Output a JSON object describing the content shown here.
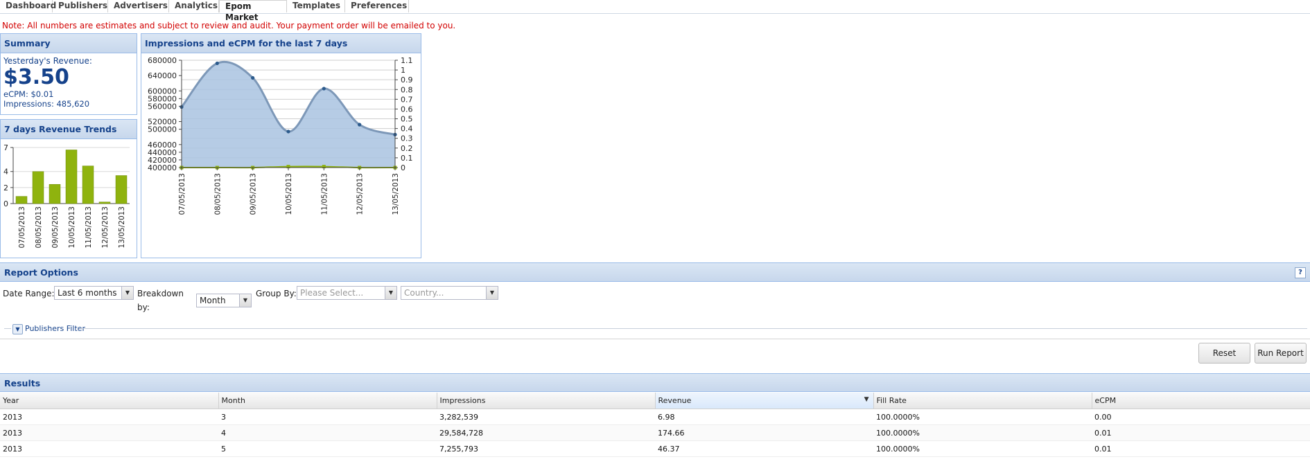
{
  "tabs": [
    "Dashboard",
    "Publishers",
    "Advertisers",
    "Analytics",
    "Epom Market",
    "Templates",
    "Preferences"
  ],
  "active_tab": "Epom Market",
  "note": "Note: All numbers are estimates and subject to review and audit. Your payment order will be emailed to you.",
  "summary": {
    "title": "Summary",
    "revenue_label": "Yesterday's Revenue:",
    "revenue": "$3.50",
    "ecpm": "eCPM: $0.01",
    "impressions": "Impressions: 485,620"
  },
  "trends": {
    "title": "7 days Revenue Trends"
  },
  "impressions_chart": {
    "title": "Impressions and eCPM for the last 7 days"
  },
  "chart_data": [
    {
      "type": "bar",
      "title": "7 days Revenue Trends",
      "categories": [
        "07/05/2013",
        "08/05/2013",
        "09/05/2013",
        "10/05/2013",
        "11/05/2013",
        "12/05/2013",
        "13/05/2013"
      ],
      "values": [
        0.9,
        4.0,
        2.4,
        6.7,
        4.7,
        0.2,
        3.5
      ],
      "ylim": [
        0,
        7
      ],
      "yticks": [
        0,
        2,
        4,
        7
      ],
      "color": "#8fb30e"
    },
    {
      "type": "area",
      "title": "Impressions and eCPM for the last 7 days",
      "categories": [
        "07/05/2013",
        "08/05/2013",
        "09/05/2013",
        "10/05/2013",
        "11/05/2013",
        "12/05/2013",
        "13/05/2013"
      ],
      "series": [
        {
          "axis": "left",
          "values": [
            558000,
            672000,
            634000,
            494000,
            606000,
            512000,
            486000
          ],
          "color": "#336699"
        },
        {
          "axis": "right",
          "values": [
            0.0,
            0.0,
            0.0,
            0.01,
            0.01,
            0.0,
            0.0
          ],
          "color": "#8fb30e"
        }
      ],
      "left_ylim": [
        400000,
        680000
      ],
      "left_yticks": [
        400000,
        420000,
        440000,
        460000,
        500000,
        520000,
        560000,
        580000,
        600000,
        640000,
        680000
      ],
      "right_ylim": [
        0,
        1.1
      ],
      "right_yticks": [
        0,
        0.1,
        0.2,
        0.3,
        0.4,
        0.5,
        0.6,
        0.7,
        0.8,
        0.9,
        1,
        1.1
      ]
    }
  ],
  "report_options": {
    "title": "Report Options",
    "help": "?",
    "date_range_label": "Date Range:",
    "date_range_value": "Last 6 months",
    "breakdown_label_1": "Breakdown",
    "breakdown_label_2": "by:",
    "breakdown_value": "Month",
    "group_by_label": "Group By:",
    "group_by_placeholder": "Please Select...",
    "country_placeholder": "Country...",
    "publishers_filter": "Publishers Filter",
    "reset": "Reset",
    "run_report": "Run Report"
  },
  "results": {
    "title": "Results",
    "columns": [
      "Year",
      "Month",
      "Impressions",
      "Revenue",
      "Fill Rate",
      "eCPM"
    ],
    "rows": [
      [
        "2013",
        "3",
        "3,282,539",
        "6.98",
        "100.0000%",
        "0.00"
      ],
      [
        "2013",
        "4",
        "29,584,728",
        "174.66",
        "100.0000%",
        "0.01"
      ],
      [
        "2013",
        "5",
        "7,255,793",
        "46.37",
        "100.0000%",
        "0.01"
      ]
    ]
  }
}
